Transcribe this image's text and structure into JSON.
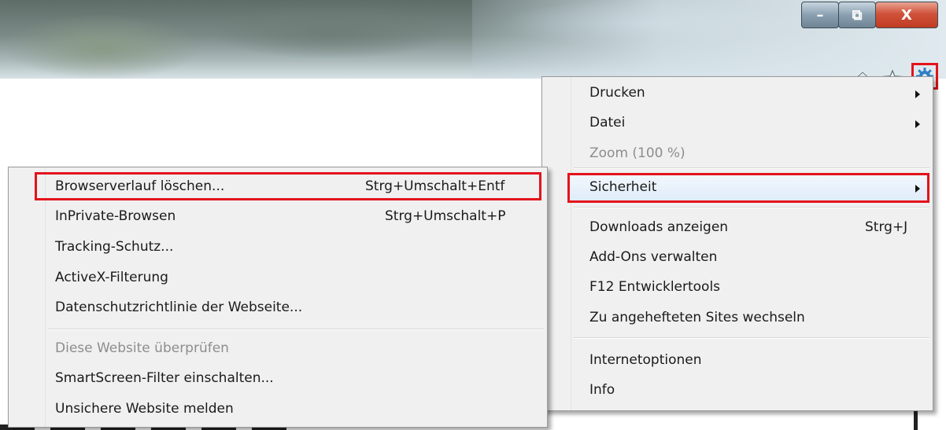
{
  "window": {
    "minimize_glyph": "–",
    "maximize_glyph": "⧉",
    "close_glyph": "X"
  },
  "toolbar": {
    "icons": [
      "home-icon",
      "star-icon",
      "gear-icon"
    ],
    "accent_color": "#e3131b"
  },
  "main_menu": {
    "items": [
      {
        "label": "Drucken",
        "submenu": true
      },
      {
        "label": "Datei",
        "submenu": true
      },
      {
        "label": "Zoom (100 %)",
        "disabled": true
      },
      {
        "label": "Sicherheit",
        "submenu": true,
        "selected": true
      },
      {
        "label": "Downloads anzeigen",
        "shortcut": "Strg+J"
      },
      {
        "label": "Add-Ons verwalten"
      },
      {
        "label": "F12 Entwicklertools"
      },
      {
        "label": "Zu angehefteten Sites wechseln"
      },
      {
        "label": "Internetoptionen"
      },
      {
        "label": "Info"
      }
    ]
  },
  "security_submenu": {
    "items": [
      {
        "label": "Browserverlauf löschen...",
        "shortcut": "Strg+Umschalt+Entf",
        "highlighted": true
      },
      {
        "label": "InPrivate-Browsen",
        "shortcut": "Strg+Umschalt+P"
      },
      {
        "label": "Tracking-Schutz..."
      },
      {
        "label": "ActiveX-Filterung"
      },
      {
        "label": "Datenschutzrichtlinie der Webseite..."
      },
      {
        "label": "Diese Website überprüfen",
        "disabled": true
      },
      {
        "label": "SmartScreen-Filter einschalten..."
      },
      {
        "label": "Unsichere Website melden"
      }
    ]
  }
}
